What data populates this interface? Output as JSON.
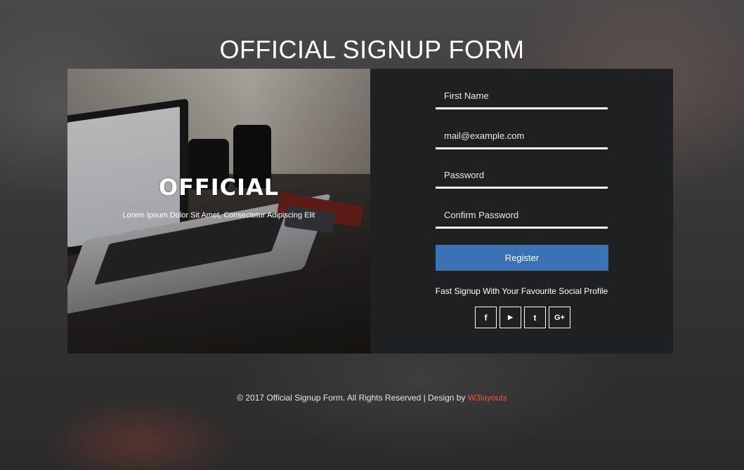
{
  "header": {
    "title": "OFFICIAL SIGNUP FORM"
  },
  "hero": {
    "brand": "OFFICIAL",
    "tagline": "Lorem Ipsum Dolor Sit Amet, Consectetur Adipiscing Elit"
  },
  "form": {
    "first_name": {
      "placeholder": "First Name",
      "value": ""
    },
    "email": {
      "placeholder": "mail@example.com",
      "value": ""
    },
    "password": {
      "placeholder": "Password",
      "value": ""
    },
    "confirm_password": {
      "placeholder": "Confirm Password",
      "value": ""
    },
    "register_label": "Register",
    "social_text": "Fast Signup With Your Favourite Social Profile",
    "socials": [
      {
        "icon": "facebook-icon",
        "glyph": "f"
      },
      {
        "icon": "youtube-icon",
        "glyph": "▶"
      },
      {
        "icon": "twitter-icon",
        "glyph": "t"
      },
      {
        "icon": "google-plus-icon",
        "glyph": "G+"
      }
    ]
  },
  "footer": {
    "text": "© 2017 Official Signup Form. All Rights Reserved | Design by ",
    "link_label": "W3layouts",
    "link_color": "#e8563f"
  },
  "colors": {
    "accent": "#3a72b5",
    "panel": "#1f2021"
  }
}
